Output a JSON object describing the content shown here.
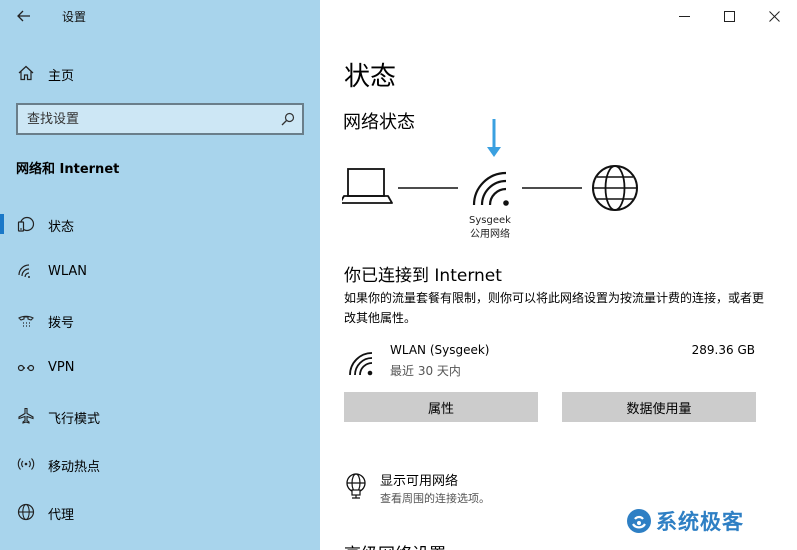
{
  "window": {
    "title": "设置"
  },
  "sidebar": {
    "home_label": "主页",
    "search_placeholder": "查找设置",
    "section_title": "网络和 Internet",
    "items": [
      {
        "label": "状态",
        "icon": "status-icon",
        "selected": true
      },
      {
        "label": "WLAN",
        "icon": "wifi-icon"
      },
      {
        "label": "拨号",
        "icon": "dialup-icon"
      },
      {
        "label": "VPN",
        "icon": "vpn-icon"
      },
      {
        "label": "飞行模式",
        "icon": "airplane-icon"
      },
      {
        "label": "移动热点",
        "icon": "hotspot-icon"
      },
      {
        "label": "代理",
        "icon": "globe-icon"
      }
    ]
  },
  "main": {
    "page_title": "状态",
    "network_status_heading": "网络状态",
    "network": {
      "name": "Sysgeek",
      "type": "公用网络"
    },
    "connected_title": "你已连接到 Internet",
    "connected_desc": "如果你的流量套餐有限制，则你可以将此网络设置为按流量计费的连接，或者更改其他属性。",
    "adapter": {
      "name": "WLAN (Sysgeek)",
      "period": "最近 30 天内",
      "usage": "289.36 GB"
    },
    "buttons": {
      "properties": "属性",
      "data_usage": "数据使用量"
    },
    "show_networks": {
      "title": "显示可用网络",
      "subtitle": "查看周围的连接选项。"
    },
    "advanced_heading": "高级网络设置"
  },
  "watermark": {
    "text": "系统极客"
  },
  "colors": {
    "sidebar_bg": "#a8d4ec",
    "accent": "#1a78c8",
    "arrow": "#3aa0e0",
    "button_bg": "#cccccc"
  }
}
